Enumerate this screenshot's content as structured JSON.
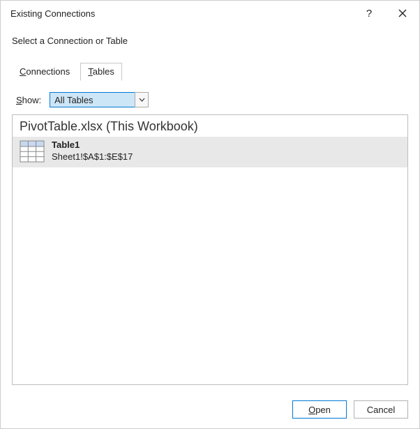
{
  "titlebar": {
    "title": "Existing Connections"
  },
  "subtitle": "Select a Connection or Table",
  "tabs": [
    {
      "label": "Connections",
      "underline_index": 0,
      "active": false
    },
    {
      "label": "Tables",
      "underline_index": 0,
      "active": true
    }
  ],
  "show": {
    "label": "Show:",
    "label_underline_index": 0,
    "value": "All Tables"
  },
  "group": {
    "header": "PivotTable.xlsx (This Workbook)",
    "items": [
      {
        "title": "Table1",
        "subtitle": "Sheet1!$A$1:$E$17"
      }
    ]
  },
  "buttons": {
    "open": "Open",
    "open_underline_index": 0,
    "cancel": "Cancel"
  }
}
